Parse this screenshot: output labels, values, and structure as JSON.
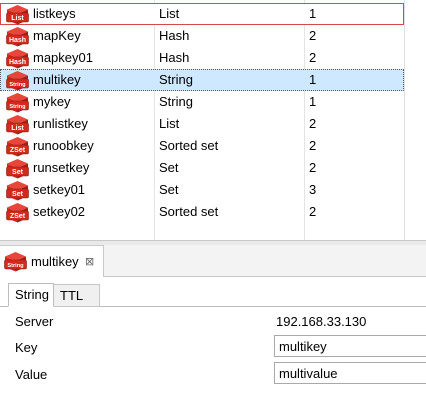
{
  "keys": [
    {
      "name": "listkeys",
      "type": "List",
      "count": "1",
      "icon": "List"
    },
    {
      "name": "mapKey",
      "type": "Hash",
      "count": "2",
      "icon": "Hash"
    },
    {
      "name": "mapkey01",
      "type": "Hash",
      "count": "2",
      "icon": "Hash"
    },
    {
      "name": "multikey",
      "type": "String",
      "count": "1",
      "icon": "String"
    },
    {
      "name": "mykey",
      "type": "String",
      "count": "1",
      "icon": "String"
    },
    {
      "name": "runlistkey",
      "type": "List",
      "count": "2",
      "icon": "List"
    },
    {
      "name": "runoobkey",
      "type": "Sorted set",
      "count": "2",
      "icon": "ZSet"
    },
    {
      "name": "runsetkey",
      "type": "Set",
      "count": "2",
      "icon": "Set"
    },
    {
      "name": "setkey01",
      "type": "Set",
      "count": "3",
      "icon": "Set"
    },
    {
      "name": "setkey02",
      "type": "Sorted set",
      "count": "2",
      "icon": "ZSet"
    }
  ],
  "editor": {
    "tab_title": "multikey",
    "tab_icon": "String",
    "close_glyph": "⊠",
    "subtabs": {
      "string": "String",
      "ttl": "TTL"
    },
    "server_label": "Server",
    "server_value": "192.168.33.130",
    "key_label": "Key",
    "key_value": "multikey",
    "value_label": "Value",
    "value_value": "multivalue"
  },
  "colors": {
    "icon_red": "#d42a1e",
    "selection_blue": "#cde8ff",
    "focus_red": "#d54949"
  },
  "icons": {
    "row_icon": "redis-cube-icon",
    "tab_close": "close-icon"
  }
}
